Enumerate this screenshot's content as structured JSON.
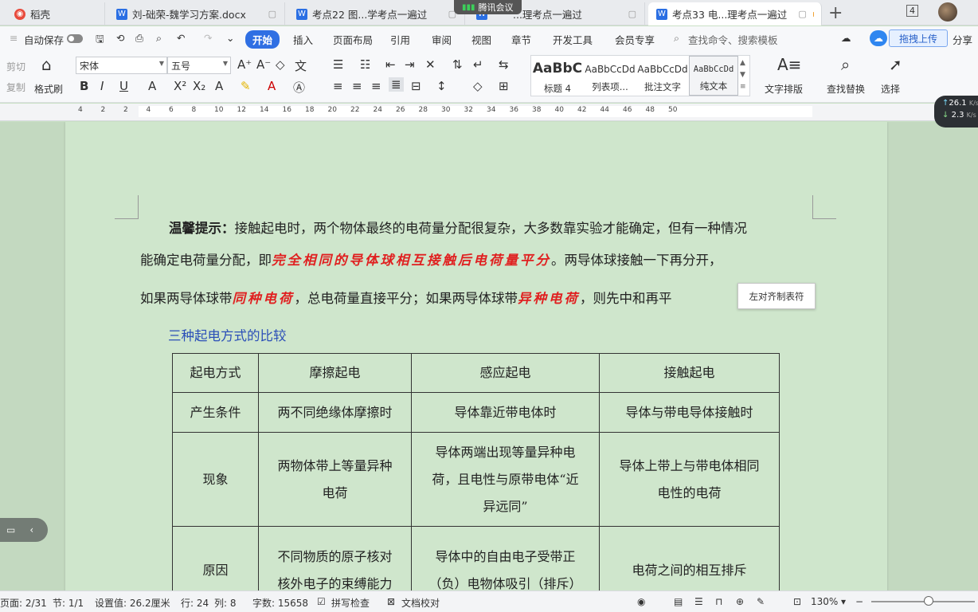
{
  "tabs": [
    {
      "label": "稻壳"
    },
    {
      "label": "刘-础荣-魏学习方案.docx"
    },
    {
      "label": "考点22 图...学考点一遍过"
    },
    {
      "label": "...理考点一遍过"
    },
    {
      "label": "考点33 电...理考点一遍过"
    }
  ],
  "meeting": {
    "label": "腾讯会议"
  },
  "tab_count": "4",
  "menu": {
    "autosave": "自动保存",
    "items": [
      "开始",
      "插入",
      "页面布局",
      "引用",
      "审阅",
      "视图",
      "章节",
      "开发工具",
      "会员专享"
    ],
    "search": "查找命令、搜索模板",
    "upload": "拖拽上传",
    "share": "分享"
  },
  "ribbon": {
    "cut": "剪切",
    "copy": "复制",
    "format_painter": "格式刷",
    "font_name": "宋体",
    "font_size": "五号",
    "styles": [
      {
        "preview": "AaBbC",
        "label": "标题 4"
      },
      {
        "preview": "AaBbCcDd",
        "label": "列表项..."
      },
      {
        "preview": "AaBbCcDd",
        "label": "批注文字"
      },
      {
        "preview": "AaBbCcDd",
        "label": "纯文本"
      }
    ],
    "text_layout": "文字排版",
    "find_replace": "查找替换",
    "select": "选择"
  },
  "ruler_numbers": [
    "4",
    "2",
    "2",
    "4",
    "6",
    "8",
    "10",
    "12",
    "14",
    "16",
    "18",
    "20",
    "22",
    "24",
    "26",
    "28",
    "30",
    "32",
    "34",
    "36",
    "38",
    "40",
    "42",
    "44",
    "46",
    "48",
    "50"
  ],
  "net_speed": {
    "up": "26.1",
    "down": "2.3",
    "unit": "K/s"
  },
  "document": {
    "tip_label": "温馨提示：",
    "line1_rest": "接触起电时，两个物体最终的电荷量分配很复杂，大多数靠实验才能确定，但有一种情况",
    "line2_pre": "能确定电荷量分配，即",
    "line2_hl": "完全相同的导体球相互接触后电荷量平分",
    "line2_post": "。两导体球接触一下再分开，",
    "line3_pre": "如果两导体球带",
    "line3_hl1": "同种电荷",
    "line3_mid": "，总电荷量直接平分；如果两导体球带",
    "line3_hl2": "异种电荷",
    "line3_post": "，则先中和再平",
    "section_title": "三种起电方式的比较",
    "tooltip": "左对齐制表符",
    "table": {
      "headers": [
        "起电方式",
        "摩擦起电",
        "感应起电",
        "接触起电"
      ],
      "row_condition": [
        "产生条件",
        "两不同绝缘体摩擦时",
        "导体靠近带电体时",
        "导体与带电导体接触时"
      ],
      "row_phenomenon": [
        "现象",
        "两物体带上等量异种",
        "电荷",
        "导体两端出现等量异种电",
        "荷，且电性与原带电体“近",
        "异远同”",
        "导体上带上与带电体相同",
        "电性的电荷"
      ],
      "row_reason": [
        "原因",
        "不同物质的原子核对",
        "核外电子的束缚能力",
        "导体中的自由电子受带正",
        "（负）电物体吸引（排斥）",
        "电荷之间的相互排斥"
      ]
    }
  },
  "status": {
    "page": "页面: 2/31",
    "section": "节: 1/1",
    "setting": "设置值: 26.2厘米",
    "row": "行: 24",
    "col": "列: 8",
    "words": "字数: 15658",
    "spell": "拼写检查",
    "doc_check": "文档校对",
    "zoom": "130%"
  }
}
